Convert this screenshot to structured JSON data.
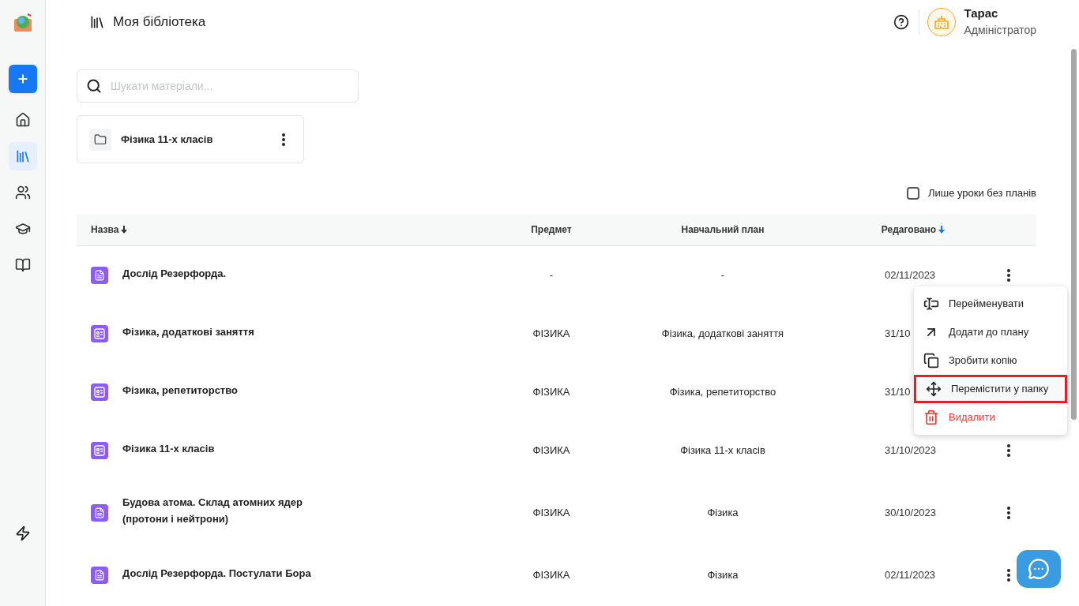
{
  "sidebar": {
    "items": [
      {
        "kind": "add",
        "selected": false
      },
      {
        "kind": "home",
        "selected": false
      },
      {
        "kind": "library",
        "selected": true
      },
      {
        "kind": "people",
        "selected": false
      },
      {
        "kind": "graduation",
        "selected": false
      },
      {
        "kind": "journal",
        "selected": false
      }
    ]
  },
  "header": {
    "title": "Моя бібліотека",
    "user": {
      "name": "Тарас",
      "role": "Адміністратор"
    }
  },
  "search": {
    "placeholder": "Шукати матеріали..."
  },
  "folders": [
    {
      "name": "Фізика 11-х класів"
    }
  ],
  "filter": {
    "label": "Лише уроки без планів",
    "checked": false
  },
  "table": {
    "columns": [
      {
        "label": "Назва",
        "sorted": true,
        "color": "#333333"
      },
      {
        "label": "Предмет",
        "sorted": false
      },
      {
        "label": "Навчальний план",
        "sorted": false
      },
      {
        "label": "Редаговано",
        "sorted": true,
        "color": "#1877f2"
      }
    ],
    "rows": [
      {
        "kind": "lesson",
        "name": "Дослід Резерфорда.",
        "subject": "-",
        "plan": "-",
        "edited": "02/11/2023"
      },
      {
        "kind": "plan",
        "name": "Фізика, додаткові заняття",
        "subject": "ФІЗИКА",
        "plan": "Фізика, додаткові заняття",
        "edited": "31/10"
      },
      {
        "kind": "plan",
        "name": "Фізика, репетиторство",
        "subject": "ФІЗИКА",
        "plan": "Фізика, репетиторство",
        "edited": "31/10"
      },
      {
        "kind": "plan",
        "name": "Фізика 11-х класів",
        "subject": "ФІЗИКА",
        "plan": "Фізика 11-х класів",
        "edited": "31/10/2023"
      },
      {
        "kind": "lesson",
        "name": "Будова атома. Склад атомних ядер (протони і нейтрони)",
        "subject": "ФІЗИКА",
        "plan": "Фізика",
        "edited": "30/10/2023"
      },
      {
        "kind": "lesson",
        "name": "Дослід Резерфорда. Постулати Бора",
        "subject": "ФІЗИКА",
        "plan": "Фізика",
        "edited": "02/11/2023"
      }
    ]
  },
  "menu": {
    "items": [
      {
        "kind": "rename",
        "label": "Перейменувати",
        "selected": false
      },
      {
        "kind": "add",
        "label": "Додати до плану",
        "selected": false
      },
      {
        "kind": "copy",
        "label": "Зробити копію",
        "selected": false
      },
      {
        "kind": "move",
        "label": "Перемістити у папку",
        "selected": true
      },
      {
        "kind": "delete",
        "label": "Видалити",
        "selected": false
      }
    ]
  }
}
